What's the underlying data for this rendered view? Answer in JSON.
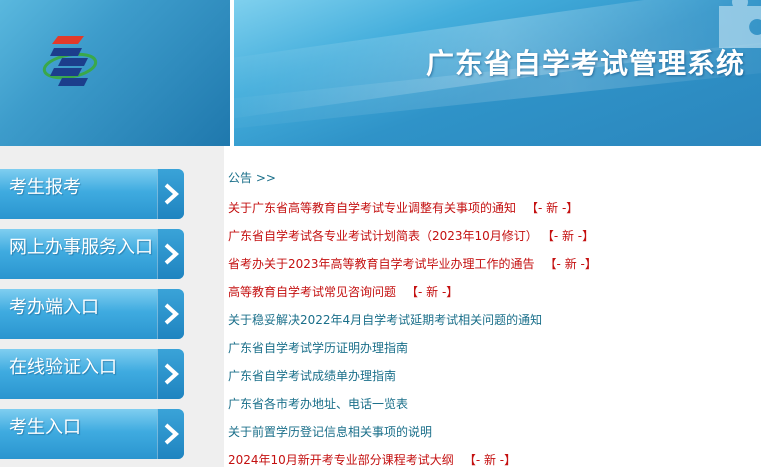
{
  "header": {
    "title": "广东省自学考试管理系统"
  },
  "sidebar": {
    "items": [
      {
        "label": "考生报考"
      },
      {
        "label": "网上办事服务入口"
      },
      {
        "label": "考办端入口"
      },
      {
        "label": "在线验证入口"
      },
      {
        "label": "考生入口"
      }
    ]
  },
  "announcements": {
    "title": "公告 >>",
    "new_badge": "【- 新 -】",
    "items": [
      {
        "text": "关于广东省高等教育自学考试专业调整有关事项的通知",
        "is_new": true
      },
      {
        "text": "广东省自学考试各专业考试计划简表（2023年10月修订）",
        "is_new": true
      },
      {
        "text": "省考办关于2023年高等教育自学考试毕业办理工作的通告",
        "is_new": true
      },
      {
        "text": "高等教育自学考试常见咨询问题",
        "is_new": true
      },
      {
        "text": "关于稳妥解决2022年4月自学考试延期考试相关问题的通知",
        "is_new": false
      },
      {
        "text": "广东省自学考试学历证明办理指南",
        "is_new": false
      },
      {
        "text": "广东省自学考试成绩单办理指南",
        "is_new": false
      },
      {
        "text": "广东省各市考办地址、电话一览表",
        "is_new": false
      },
      {
        "text": "关于前置学历登记信息相关事项的说明",
        "is_new": false
      },
      {
        "text": "2024年10月新开考专业部分课程考试大纲",
        "is_new": true
      }
    ]
  },
  "colors": {
    "new_item": "#c41010",
    "normal_item": "#1a6f8a",
    "sidebar_bg": "#efefef",
    "nav_button": "#3fabe0"
  },
  "icons": {
    "logo": "exam-logo-icon",
    "nav_arrow": "chevron-right-icon",
    "decoration": "puzzle-icon"
  }
}
